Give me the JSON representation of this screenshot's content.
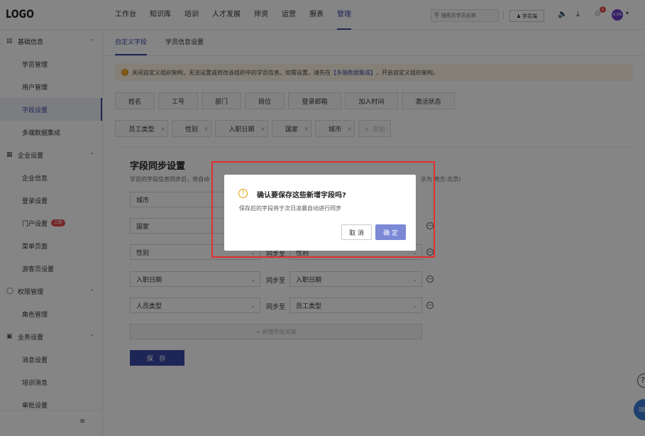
{
  "app": {
    "logo": "LOGO"
  },
  "nav": {
    "items": [
      "工作台",
      "知识库",
      "培训",
      "人才发展",
      "师资",
      "运营",
      "报表",
      "管理"
    ],
    "active_index": 7
  },
  "header": {
    "search_placeholder": "搜索员学员名称",
    "portal_label": "学员端",
    "notification_count": "1",
    "avatar_text": "ICON"
  },
  "sidebar": {
    "groups": [
      {
        "label": "基础信息",
        "icon": "document-icon",
        "items": [
          {
            "label": "学员管理"
          },
          {
            "label": "用户管理"
          },
          {
            "label": "字段设置",
            "active": true
          },
          {
            "label": "多端数据集成"
          }
        ]
      },
      {
        "label": "企业设置",
        "icon": "building-icon",
        "items": [
          {
            "label": "企业信息"
          },
          {
            "label": "登录设置"
          },
          {
            "label": "门户设置",
            "tag": "上新"
          },
          {
            "label": "菜单页面"
          },
          {
            "label": "游客页设置"
          }
        ]
      },
      {
        "label": "权限管理",
        "icon": "shield-icon",
        "items": [
          {
            "label": "角色管理"
          }
        ]
      },
      {
        "label": "业务设置",
        "icon": "briefcase-icon",
        "items": [
          {
            "label": "消息设置"
          },
          {
            "label": "培训消息"
          },
          {
            "label": "审批设置"
          }
        ]
      }
    ]
  },
  "tabs": [
    "自定义字段",
    "学员信息设置"
  ],
  "alert": {
    "text_before": "关闭自定义组织架构，无法设置或修改该组织中的学员信息。如需设置，请先在",
    "link": "【多端数据集成】",
    "text_after": "，开启自定义组织架构。"
  },
  "fixed_fields": [
    "姓名",
    "工号",
    "部门",
    "岗位",
    "登录邮箱",
    "加入时间",
    "激活状态"
  ],
  "custom_fields": [
    "员工类型",
    "性别",
    "入职日期",
    "国家",
    "城市"
  ],
  "add_field_label": "+ 添加",
  "sync": {
    "title": "字段同步设置",
    "desc": "学员的字段信息同步后，将自动",
    "desc_tail": "示为 地方:北京)",
    "sync_to_label": "同步至",
    "rows": [
      {
        "source": "城市",
        "target": ""
      },
      {
        "source": "国家",
        "target": ""
      },
      {
        "source": "性别",
        "target": "性别"
      },
      {
        "source": "入职日期",
        "target": "入职日期"
      },
      {
        "source": "人员类型",
        "target": "员工类型"
      }
    ],
    "add_assoc_label": "+ 新增字段关联",
    "save_label": "保 存"
  },
  "modal": {
    "title": "确认要保存这些新增字段吗?",
    "body": "保存后的字段将于次日凌晨自动进行同步",
    "cancel": "取 消",
    "ok": "确 定"
  },
  "colors": {
    "accent": "#3a49a8",
    "highlight": "#e0302e",
    "warning": "#f0a020"
  }
}
